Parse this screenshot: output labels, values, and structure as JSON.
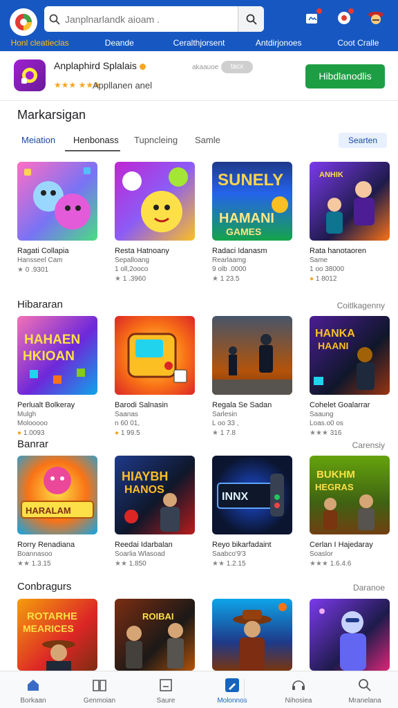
{
  "header": {
    "search_placeholder": "Janplnarlandk aioam .",
    "nav": [
      "Honl cleatieclas",
      "Deande",
      "Ceralthjorsent",
      "Antdirjonoes",
      "Coot Cralle"
    ]
  },
  "promo": {
    "app_name": "Anplaphird Splalais",
    "stars": "★★★ ★★★",
    "subtitle": "Appllanen anel",
    "small_text": "akaauoe",
    "pill": "tacx",
    "install_label": "Hibdlanodlis"
  },
  "main": {
    "title": "Markarsigan",
    "tabs": [
      "Meiation",
      "Henbonass",
      "Tupncleing",
      "Samle"
    ],
    "sort_label": "Searten"
  },
  "rows": [
    {
      "title": "",
      "more": "",
      "cards": [
        {
          "name": "Ragati Collapia",
          "category": "Hansseel Cam",
          "rating": "0 .9301"
        },
        {
          "name": "Resta Hatnoany",
          "category": "Sepalloang",
          "sub": "1 oll,2ooco",
          "rating": "1 .3960"
        },
        {
          "name": "Radaci Idanasm",
          "category": "Rearlaamg",
          "sub": "9 olb .0000",
          "rating": "1 23.5"
        },
        {
          "name": "Rata hanotaoren",
          "category": "Same",
          "sub": "1 oo 38000",
          "rating": "1 8012"
        }
      ]
    },
    {
      "title": "Hibararan",
      "more": "Coitlkagenny",
      "cards": [
        {
          "name": "Perlualt Bolkeray",
          "category": "Mulgh",
          "sub": "Molooooo",
          "rating": "1.0093"
        },
        {
          "name": "Barodi Salnasin",
          "category": "Saanas",
          "sub": "n 60 01,",
          "rating": "1 99.5"
        },
        {
          "name": "Regala Se Sadan",
          "category": "Sarlesin",
          "sub": "L oo 33 ,",
          "rating": "1 7.8"
        },
        {
          "name": "Cohelet Goalarrar",
          "category": "Saaung",
          "sub": "Loas.o0 os",
          "rating": "316"
        }
      ]
    },
    {
      "title": "Banrar",
      "more": "Carensiy",
      "cards": [
        {
          "name": "Rorry Renadiana",
          "category": "Boannasoo",
          "rating": "1.3.15"
        },
        {
          "name": "Reedai Idarbalan",
          "category": "Soarlia Wlasoad",
          "rating": "1.850"
        },
        {
          "name": "Reyo bikarfadaint",
          "category": "Saabco'9'3",
          "rating": "1.2.15"
        },
        {
          "name": "Cerlan I Hajedaray",
          "category": "Soaslor",
          "rating": "1.6.4.6"
        }
      ]
    },
    {
      "title": "Conbragurs",
      "more": "Daranoe",
      "cards": [
        {},
        {},
        {},
        {}
      ]
    }
  ],
  "bottom_nav": [
    {
      "label": "Borkaan",
      "icon": "home-icon"
    },
    {
      "label": "Genmoian",
      "icon": "book-icon"
    },
    {
      "label": "Saure",
      "icon": "square-icon"
    },
    {
      "label": "Molonnos",
      "icon": "pen-icon"
    },
    {
      "label": "Nihosiea",
      "icon": "headset-icon"
    },
    {
      "label": "Mranelana",
      "icon": "search-icon"
    }
  ]
}
